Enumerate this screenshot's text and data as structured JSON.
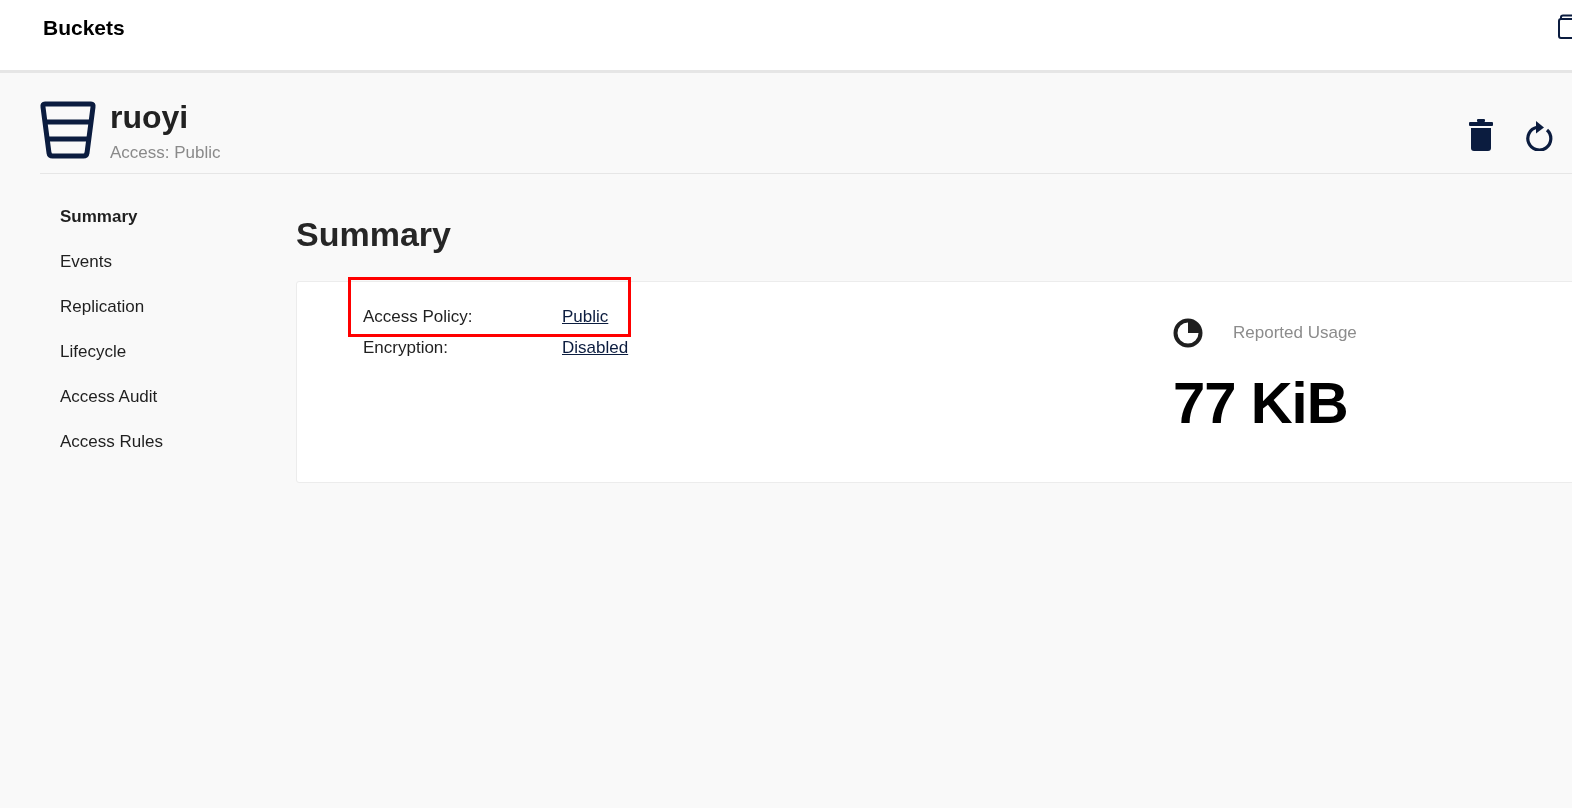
{
  "topbar": {
    "title": "Buckets"
  },
  "bucket": {
    "name": "ruoyi",
    "access": "Access: Public"
  },
  "sidebar": {
    "items": [
      {
        "label": "Summary",
        "selected": true
      },
      {
        "label": "Events",
        "selected": false
      },
      {
        "label": "Replication",
        "selected": false
      },
      {
        "label": "Lifecycle",
        "selected": false
      },
      {
        "label": "Access Audit",
        "selected": false
      },
      {
        "label": "Access Rules",
        "selected": false
      }
    ]
  },
  "summary": {
    "heading": "Summary",
    "details": [
      {
        "label": "Access Policy:",
        "value": "Public",
        "highlighted": true
      },
      {
        "label": "Encryption:",
        "value": "Disabled",
        "highlighted": false
      }
    ],
    "usage": {
      "label": "Reported Usage",
      "value": "77 KiB"
    }
  }
}
